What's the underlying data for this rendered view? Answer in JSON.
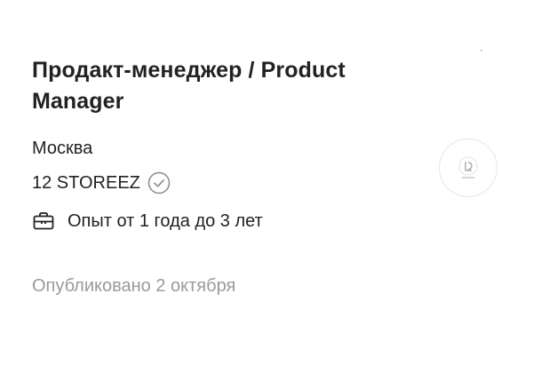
{
  "vacancy": {
    "title": "Продакт-менеджер / Product Manager",
    "city": "Москва",
    "company": "12 STOREEZ",
    "experience": "Опыт от 1 года до 3 лет",
    "published": "Опубликовано 2 октября"
  },
  "icons": {
    "verified": "check-circle-icon",
    "experience": "briefcase-icon"
  },
  "colors": {
    "text": "#222222",
    "muted": "#9a9a9a"
  }
}
